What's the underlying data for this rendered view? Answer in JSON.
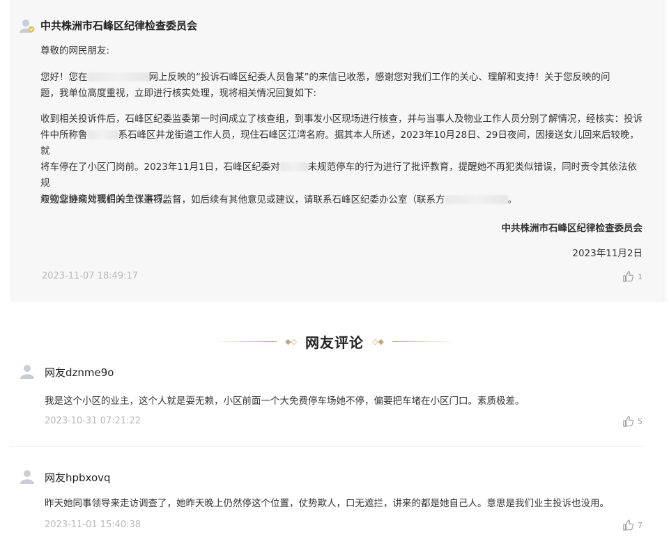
{
  "reply": {
    "org_name": "中共株洲市石峰区纪律检查委员会",
    "salutation": "尊敬的网民朋友:",
    "para1_part1": "您好！您在",
    "para1_part2": "网上反映的“投诉石峰区纪委人员鲁某”的来信已收悉，感谢您对我们工作的关心、理解和支持！关于您反映的问",
    "para1_line2": "题，我单位高度重视，立即进行核实处理，现将相关情况回复如下:",
    "para2_line1": "收到相关投诉件后，石峰区纪委监委第一时间成立了核查组，到事发小区现场进行核查，并与当事人及物业工作人员分别了解情况，经核实：投诉",
    "para2_line2_a": "件中所称鲁",
    "para2_line2_b": "系石峰区井龙街道工作人员，现住石峰区江湾名府。据其本人所述，2023年10月28日、29日夜间，因接送女儿回来后较晚，就",
    "para2_line3_a": "将车停在了小区门岗前。2023年11月1日，石峰区纪委对",
    "para2_line3_b": "未规范停车的行为进行了批评教育，提醒她不再犯类似错误，同时责令其依法依规",
    "para2_line4": "与物业协商处理相关争议事项。",
    "para3_a": "欢迎您继续对我们的工作进行监督，如后续有其他意见或建议，请联系石峰区纪委办公室（联系方",
    "para3_b": "。",
    "signature": "中共株洲市石峰区纪律检查委员会",
    "sign_date": "2023年11月2日",
    "timestamp": "2023-11-07 18:49:17",
    "likes": "1"
  },
  "section": {
    "title": "网友评论"
  },
  "comments": [
    {
      "name": "网友dznme9o",
      "text": "我是这个小区的业主，这个人就是耍无赖，小区前面一个大免费停车场她不停，偏要把车堵在小区门口。素质极差。",
      "time": "2023-10-31 07:21:22",
      "likes": "5"
    },
    {
      "name": "网友hpbxovq",
      "text": "昨天她同事领导来走访调查了，她昨天晚上仍然停这个位置，仗势欺人，口无遮拦，讲来的都是她自己人。意思是我们业主投诉也没用。",
      "time": "2023-11-01 15:40:38",
      "likes": "7"
    }
  ],
  "icons": {
    "avatar": "user-avatar-icon",
    "like": "thumbs-up-icon"
  },
  "colors": {
    "card_bg": "#f7f7f7",
    "accent_gold": "#c7a56e",
    "timestamp": "#b9b9b9"
  }
}
